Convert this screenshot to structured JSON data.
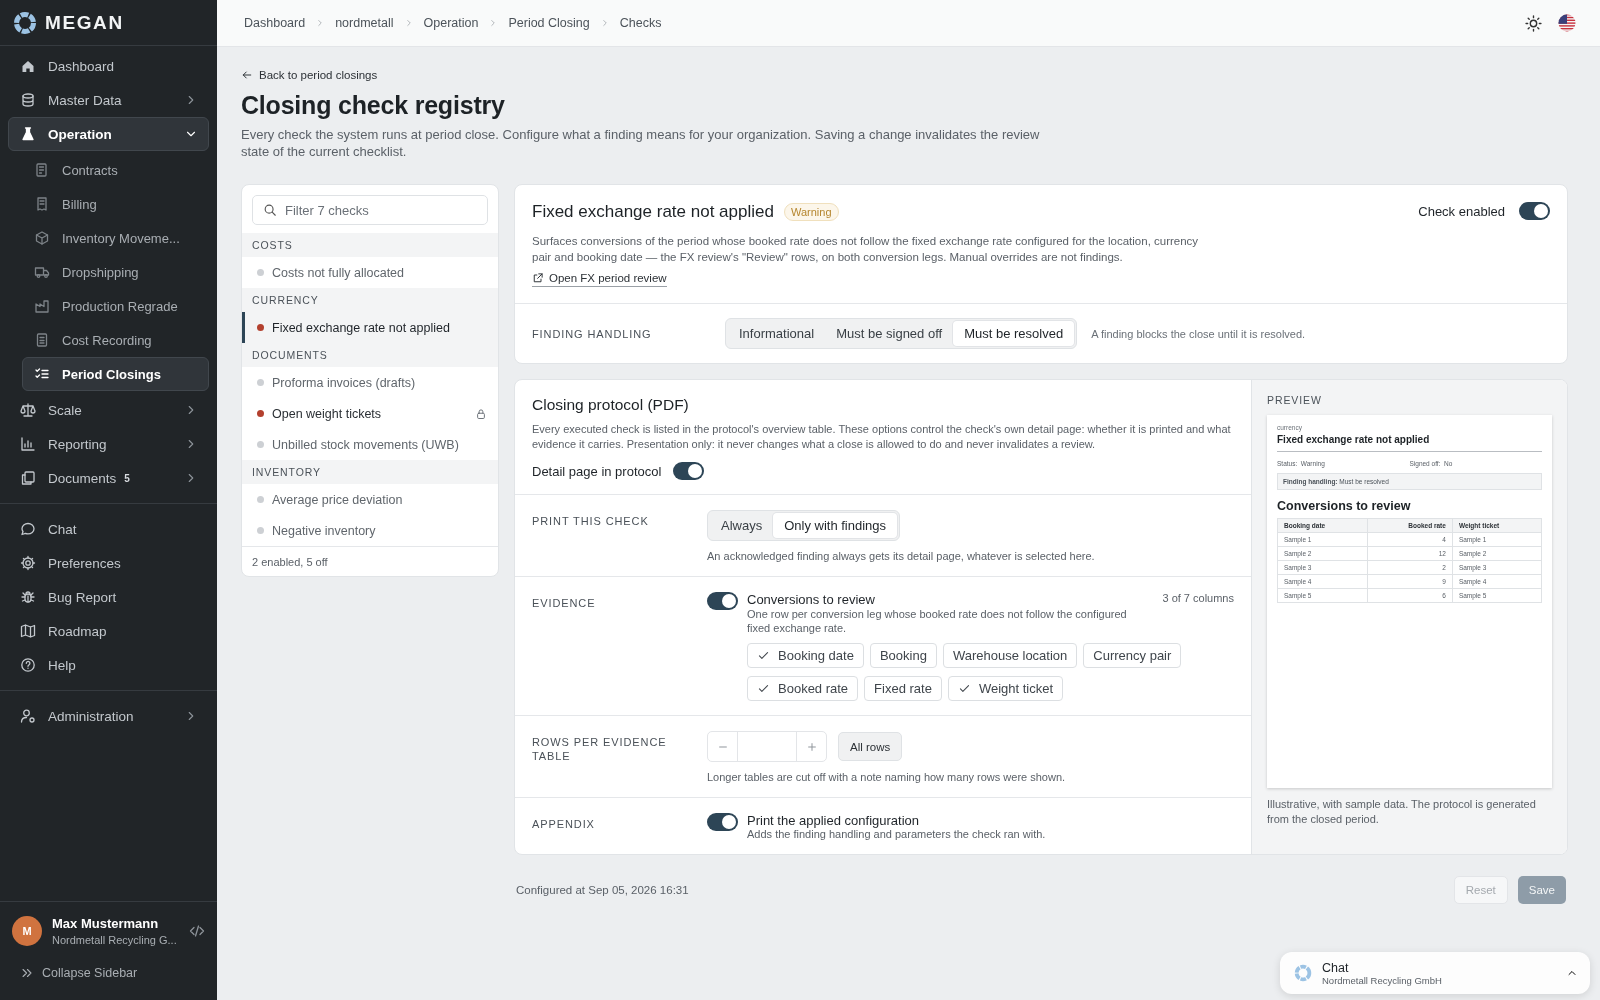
{
  "sidebar": {
    "brand": "MEGAN",
    "groups": [
      {
        "items": [
          {
            "label": "Dashboard",
            "selected": false
          },
          {
            "label": "Master Data",
            "selected": false,
            "expanded": false
          },
          {
            "label": "Operation",
            "selected": true,
            "expanded": true,
            "children": [
              {
                "label": "Contracts",
                "selected": false
              },
              {
                "label": "Billing",
                "selected": false
              },
              {
                "label": "Inventory Moveme...",
                "selected": false
              },
              {
                "label": "Dropshipping",
                "selected": false
              },
              {
                "label": "Production Regrade",
                "selected": false
              },
              {
                "label": "Cost Recording",
                "selected": false
              },
              {
                "label": "Period Closings",
                "selected": true
              }
            ]
          },
          {
            "label": "Scale",
            "selected": false,
            "expanded": false
          },
          {
            "label": "Reporting",
            "selected": false,
            "expanded": false
          },
          {
            "label": "Documents",
            "selected": false,
            "expanded": false,
            "badge": "5"
          }
        ]
      },
      {
        "items": [
          {
            "label": "Chat",
            "selected": false
          },
          {
            "label": "Preferences",
            "selected": false
          },
          {
            "label": "Bug Report",
            "selected": false
          },
          {
            "label": "Roadmap",
            "selected": false
          },
          {
            "label": "Help",
            "selected": false
          }
        ]
      },
      {
        "items": [
          {
            "label": "Administration",
            "selected": false,
            "expanded": false
          }
        ]
      }
    ],
    "user": {
      "initial": "M",
      "name": "Max Mustermann",
      "organization": "Nordmetall Recycling G..."
    },
    "collapse": "Collapse Sidebar"
  },
  "breadcrumbs": [
    "Dashboard",
    "nordmetall",
    "Operation",
    "Period Closing",
    "Checks"
  ],
  "page": {
    "back_link": "Back to period closings",
    "title": "Closing check registry",
    "description": "Every check the system runs at period close. Configure what a finding means for your organization. Saving a change invalidates the review state of the current checklist."
  },
  "check_list": {
    "placeholder": "Filter 7 checks",
    "groups": [
      {
        "label": "COSTS",
        "checks": [
          {
            "label": "Costs not fully allocated",
            "enabled": false,
            "selected": false,
            "locked": false
          }
        ]
      },
      {
        "label": "CURRENCY",
        "checks": [
          {
            "label": "Fixed exchange rate not applied",
            "enabled": true,
            "selected": true,
            "locked": false
          }
        ]
      },
      {
        "label": "DOCUMENTS",
        "checks": [
          {
            "label": "Proforma invoices (drafts)",
            "enabled": false,
            "selected": false,
            "locked": false
          },
          {
            "label": "Open weight tickets",
            "enabled": true,
            "selected": false,
            "locked": true
          },
          {
            "label": "Unbilled stock movements (UWB)",
            "enabled": false,
            "selected": false,
            "locked": false
          }
        ]
      },
      {
        "label": "INVENTORY",
        "checks": [
          {
            "label": "Average price deviation",
            "enabled": false,
            "selected": false,
            "locked": false
          },
          {
            "label": "Negative inventory",
            "enabled": false,
            "selected": false,
            "locked": false
          }
        ]
      }
    ],
    "summary": "2 enabled, 5 off"
  },
  "detail": {
    "title": "Fixed exchange rate not applied",
    "severity": "Warning",
    "enabled_label": "Check enabled",
    "enabled": true,
    "description": "Surfaces conversions of the period whose booked rate does not follow the fixed exchange rate configured for the location, currency pair and booking date — the FX review's \"Review\" rows, on both conversion legs. Manual overrides are not findings.",
    "link": "Open FX period review",
    "finding_handling": {
      "label": "FINDING HANDLING",
      "options": [
        {
          "label": "Informational",
          "selected": false
        },
        {
          "label": "Must be signed off",
          "selected": false
        },
        {
          "label": "Must be resolved",
          "selected": true
        }
      ],
      "hint": "A finding blocks the close until it is resolved."
    }
  },
  "protocol": {
    "title": "Closing protocol (PDF)",
    "description": "Every executed check is listed in the protocol's overview table. These options control the check's own detail page: whether it is printed and what evidence it carries. Presentation only: it never changes what a close is allowed to do and never invalidates a review.",
    "detail_page_label": "Detail page in protocol",
    "detail_page": true,
    "print": {
      "label": "PRINT THIS CHECK",
      "options": [
        {
          "label": "Always",
          "selected": false
        },
        {
          "label": "Only with findings",
          "selected": true
        }
      ],
      "hint": "An acknowledged finding always gets its detail page, whatever is selected here."
    },
    "evidence": {
      "label": "EVIDENCE",
      "enabled": true,
      "title": "Conversions to review",
      "count": "3 of 7 columns",
      "description": "One row per conversion leg whose booked rate does not follow the configured fixed exchange rate.",
      "columns": [
        {
          "label": "Booking date",
          "checked": true
        },
        {
          "label": "Booking",
          "checked": false
        },
        {
          "label": "Warehouse location",
          "checked": false
        },
        {
          "label": "Currency pair",
          "checked": false
        },
        {
          "label": "Booked rate",
          "checked": true
        },
        {
          "label": "Fixed rate",
          "checked": false
        },
        {
          "label": "Weight ticket",
          "checked": true
        }
      ]
    },
    "rows": {
      "label": "ROWS PER EVIDENCE TABLE",
      "all_rows": "All rows",
      "hint": "Longer tables are cut off with a note naming how many rows were shown."
    },
    "appendix": {
      "label": "APPENDIX",
      "enabled": true,
      "title": "Print the applied configuration",
      "description": "Adds the finding handling and parameters the check ran with."
    }
  },
  "preview": {
    "label": "PREVIEW",
    "category": "currency",
    "title": "Fixed exchange rate not applied",
    "status_label": "Status:",
    "status": "Warning",
    "signed_label": "Signed off:",
    "signed": "No",
    "handling_label": "Finding handling:",
    "handling": "Must be resolved",
    "table_title": "Conversions to review",
    "columns": [
      "Booking date",
      "Booked rate",
      "Weight ticket"
    ],
    "rows": [
      [
        "Sample 1",
        "4",
        "Sample 1"
      ],
      [
        "Sample 2",
        "12",
        "Sample 2"
      ],
      [
        "Sample 3",
        "2",
        "Sample 3"
      ],
      [
        "Sample 4",
        "9",
        "Sample 4"
      ],
      [
        "Sample 5",
        "6",
        "Sample 5"
      ]
    ],
    "note": "Illustrative, with sample data. The protocol is generated from the closed period."
  },
  "footer": {
    "configured": "Configured at Sep 05, 2026 16:31",
    "buttons": [
      {
        "label": "Reset",
        "kind": "secondary",
        "disabled": true
      },
      {
        "label": "Save",
        "kind": "primary",
        "disabled": true
      }
    ]
  },
  "chat": {
    "title": "Chat",
    "subtitle": "Nordmetall Recycling GmbH"
  }
}
